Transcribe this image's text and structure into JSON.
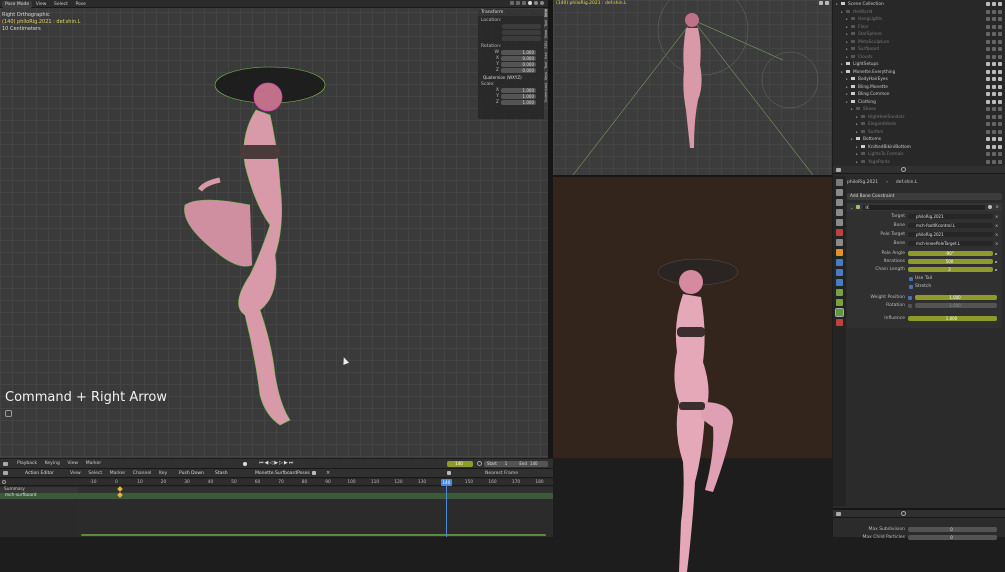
{
  "viewport_left": {
    "mode_select": "Pose Mode",
    "menus": [
      "View",
      "Select",
      "Pose"
    ],
    "view_name": "Right Orthographic",
    "object_info": "(140) philoRig.2021 : def.shin.L",
    "scale": "10 Centimeters",
    "keystroke_overlay": "Command + Right Arrow"
  },
  "transform_panel": {
    "title": "Transform",
    "location_label": "Location:",
    "rotation_label": "Rotation:",
    "rotation_values": [
      "1.000",
      "0.000",
      "0.000",
      "0.000"
    ],
    "rotation_axes": [
      "W",
      "X",
      "Y",
      "Z"
    ],
    "rotation_mode": "Quaternion (WXYZ)",
    "scale_label": "Scale:",
    "scale_values": [
      "1.000",
      "1.000",
      "1.000"
    ],
    "scale_axes": [
      "X",
      "Y",
      "Z"
    ],
    "side_tabs": [
      "Item",
      "Tool",
      "View",
      "SGU",
      "Hair",
      "Tool",
      "Keys",
      "Screencast"
    ]
  },
  "viewport_right": {
    "object_info": "(140) philoRig.2021 : def.shin.L"
  },
  "outliner": {
    "rows": [
      {
        "label": "Scene Collection",
        "indent": 0,
        "dim": false
      },
      {
        "label": "theWorld",
        "indent": 1,
        "dim": true
      },
      {
        "label": "HangLights",
        "indent": 2,
        "dim": true
      },
      {
        "label": "Floor",
        "indent": 2,
        "dim": true
      },
      {
        "label": "StarSphere",
        "indent": 2,
        "dim": true
      },
      {
        "label": "MetaSculpture",
        "indent": 2,
        "dim": true
      },
      {
        "label": "Surfboard",
        "indent": 2,
        "dim": true
      },
      {
        "label": "Clouds",
        "indent": 2,
        "dim": true
      },
      {
        "label": "LightSetups",
        "indent": 1,
        "dim": false
      },
      {
        "label": "Monette.Everything",
        "indent": 1,
        "dim": false
      },
      {
        "label": "BodyHairEyes",
        "indent": 2,
        "dim": false
      },
      {
        "label": "Bling.Monette",
        "indent": 2,
        "dim": false
      },
      {
        "label": "Bling.Common",
        "indent": 2,
        "dim": false
      },
      {
        "label": "Clothing",
        "indent": 2,
        "dim": false
      },
      {
        "label": "Shoes",
        "indent": 3,
        "dim": true
      },
      {
        "label": "HighHeelSandals",
        "indent": 4,
        "dim": true
      },
      {
        "label": "ElegantHeels",
        "indent": 4,
        "dim": true
      },
      {
        "label": "Surfers",
        "indent": 4,
        "dim": true
      },
      {
        "label": "Bottoms",
        "indent": 3,
        "dim": false
      },
      {
        "label": "KnittedBikiniBottom",
        "indent": 4,
        "dim": false
      },
      {
        "label": "LightsTo.Formals",
        "indent": 4,
        "dim": true
      },
      {
        "label": "YogaPants",
        "indent": 4,
        "dim": true
      }
    ]
  },
  "properties": {
    "breadcrumb_object": "philoRig.2021",
    "breadcrumb_bone": "def.shin.L",
    "add_constraint": "Add Bone Constraint",
    "constraint_name": "IK",
    "fields": [
      {
        "label": "Target",
        "value": "philoRig.2021",
        "kind": "object"
      },
      {
        "label": "Bone",
        "value": "mch-footIKcontrol.L",
        "kind": "bone"
      },
      {
        "label": "Pole Target",
        "value": "philoRig.2021",
        "kind": "object"
      },
      {
        "label": "Bone",
        "value": "mch-kneePoleTarget.L",
        "kind": "bone"
      },
      {
        "label": "Pole Angle",
        "value": "-90°",
        "kind": "slider"
      },
      {
        "label": "Iterations",
        "value": "500",
        "kind": "slider"
      },
      {
        "label": "Chain Length",
        "value": "2",
        "kind": "slider"
      }
    ],
    "use_tail": "Use Tail",
    "stretch": "Stretch",
    "weight_position_label": "Weight Position",
    "weight_position_value": "1.000",
    "rotation_label": "Rotation",
    "rotation_value": "1.000",
    "influence_label": "Influence",
    "influence_value": "1.000"
  },
  "bottom_right": {
    "max_subdivision_label": "Max Subdivision",
    "max_subdivision_value": "0",
    "max_child_label": "Max Child Particles",
    "max_child_value": "0"
  },
  "timeline": {
    "menus": [
      "Playback",
      "Keying",
      "View",
      "Marker"
    ],
    "current_frame": "140",
    "start_label": "Start",
    "start_value": "1",
    "end_label": "End",
    "end_value": "140"
  },
  "action_editor": {
    "editor_name": "Action Editor",
    "menus": [
      "View",
      "Select",
      "Marker",
      "Channel",
      "Key"
    ],
    "push_down": "Push Down",
    "stash": "Stash",
    "action_name": "Monette.SurfboardPoses",
    "interp": "Nearest Frame",
    "ruler": [
      "-10",
      "0",
      "10",
      "20",
      "30",
      "40",
      "50",
      "60",
      "70",
      "80",
      "90",
      "100",
      "110",
      "120",
      "130",
      "140",
      "150",
      "160",
      "170",
      "180"
    ],
    "current_frame": "140",
    "channels": [
      "Summary",
      "mch-surfboard"
    ]
  }
}
